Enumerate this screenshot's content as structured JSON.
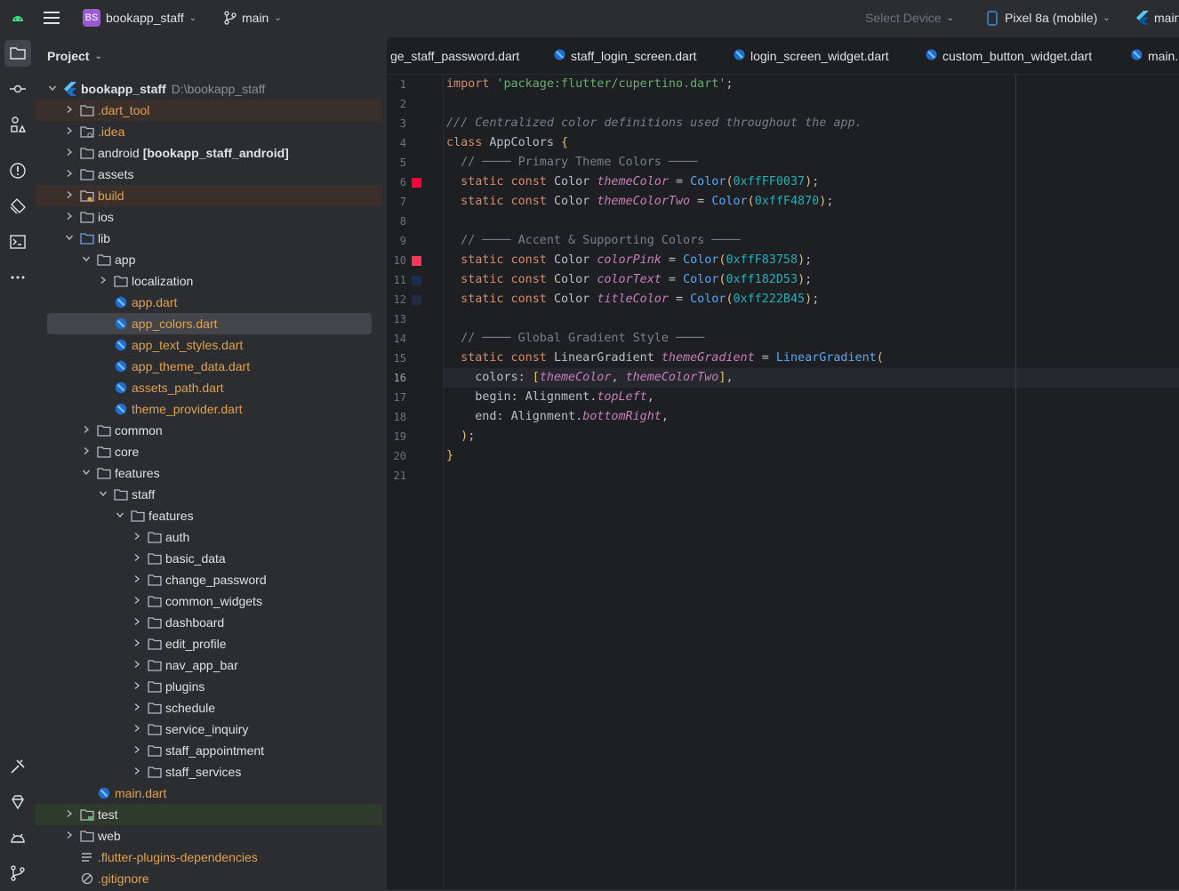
{
  "topbar": {
    "project_badge": "BS",
    "project_name": "bookapp_staff",
    "branch": "main",
    "device_select": "Select Device",
    "device": "Pixel 8a (mobile)",
    "run_config": "main"
  },
  "project_panel": {
    "title": "Project",
    "root_name": "bookapp_staff",
    "root_path": "D:\\bookapp_staff",
    "items": [
      {
        "label": ".dart_tool",
        "extra": ""
      },
      {
        "label": ".idea",
        "extra": ""
      },
      {
        "label": "android",
        "extra": "[bookapp_staff_android]"
      },
      {
        "label": "assets",
        "extra": ""
      },
      {
        "label": "build",
        "extra": ""
      },
      {
        "label": "ios",
        "extra": ""
      },
      {
        "label": "lib",
        "extra": ""
      },
      {
        "label": "app",
        "extra": ""
      },
      {
        "label": "localization",
        "extra": ""
      },
      {
        "label": "app.dart",
        "extra": ""
      },
      {
        "label": "app_colors.dart",
        "extra": ""
      },
      {
        "label": "app_text_styles.dart",
        "extra": ""
      },
      {
        "label": "app_theme_data.dart",
        "extra": ""
      },
      {
        "label": "assets_path.dart",
        "extra": ""
      },
      {
        "label": "theme_provider.dart",
        "extra": ""
      },
      {
        "label": "common",
        "extra": ""
      },
      {
        "label": "core",
        "extra": ""
      },
      {
        "label": "features",
        "extra": ""
      },
      {
        "label": "staff",
        "extra": ""
      },
      {
        "label": "features",
        "extra": ""
      },
      {
        "label": "auth",
        "extra": ""
      },
      {
        "label": "basic_data",
        "extra": ""
      },
      {
        "label": "change_password",
        "extra": ""
      },
      {
        "label": "common_widgets",
        "extra": ""
      },
      {
        "label": "dashboard",
        "extra": ""
      },
      {
        "label": "edit_profile",
        "extra": ""
      },
      {
        "label": "nav_app_bar",
        "extra": ""
      },
      {
        "label": "plugins",
        "extra": ""
      },
      {
        "label": "schedule",
        "extra": ""
      },
      {
        "label": "service_inquiry",
        "extra": ""
      },
      {
        "label": "staff_appointment",
        "extra": ""
      },
      {
        "label": "staff_services",
        "extra": ""
      },
      {
        "label": "main.dart",
        "extra": ""
      },
      {
        "label": "test",
        "extra": ""
      },
      {
        "label": "web",
        "extra": ""
      },
      {
        "label": ".flutter-plugins-dependencies",
        "extra": ""
      },
      {
        "label": ".gitignore",
        "extra": ""
      }
    ]
  },
  "tabs": [
    {
      "label": "ge_staff_password.dart"
    },
    {
      "label": "staff_login_screen.dart"
    },
    {
      "label": "login_screen_widget.dart"
    },
    {
      "label": "custom_button_widget.dart"
    },
    {
      "label": "main.dart"
    }
  ],
  "editor": {
    "current_line": "16",
    "line_numbers": [
      "1",
      "2",
      "3",
      "4",
      "5",
      "6",
      "7",
      "8",
      "9",
      "10",
      "11",
      "12",
      "13",
      "14",
      "15",
      "16",
      "17",
      "18",
      "19",
      "20",
      "21"
    ],
    "swatch_colors": {
      "line6": "#FF0037",
      "line7": "#F4870",
      "line10": "#F83758",
      "line11": "#182D53",
      "line12": "#222B45"
    },
    "code": {
      "l1_kw": "import",
      "l1_str": "'package:flutter/cupertino.dart'",
      "l1_end": ";",
      "l3": "/// Centralized color definitions used throughout the app.",
      "l4_kw": "class",
      "l4_name": " AppColors ",
      "l4_brace": "{",
      "l5": "  // ──── Primary Theme Colors ────",
      "static_kw": "static const",
      "type_color": "Color",
      "ctor_color": "Color",
      "l6_field": "themeColor",
      "l6_val": "0xffFF0037",
      "l7_field": "themeColorTwo",
      "l7_val": "0xffF4870",
      "l9": "  // ──── Accent & Supporting Colors ────",
      "l10_field": "colorPink",
      "l10_val": "0xffF83758",
      "l11_field": "colorText",
      "l11_val": "0xff182D53",
      "l12_field": "titleColor",
      "l12_val": "0xff222B45",
      "l14": "  // ──── Global Gradient Style ────",
      "l15_type": "LinearGradient",
      "l15_field": "themeGradient",
      "l15_ctor": "LinearGradient",
      "l16_key": "colors",
      "l16_a": "themeColor",
      "l16_b": "themeColorTwo",
      "l17_key": "begin",
      "l17_cls": "Alignment",
      "l17_val": "topLeft",
      "l18_key": "end",
      "l18_cls": "Alignment",
      "l18_val": "bottomRight",
      "l19": ");",
      "l20": "}"
    }
  }
}
